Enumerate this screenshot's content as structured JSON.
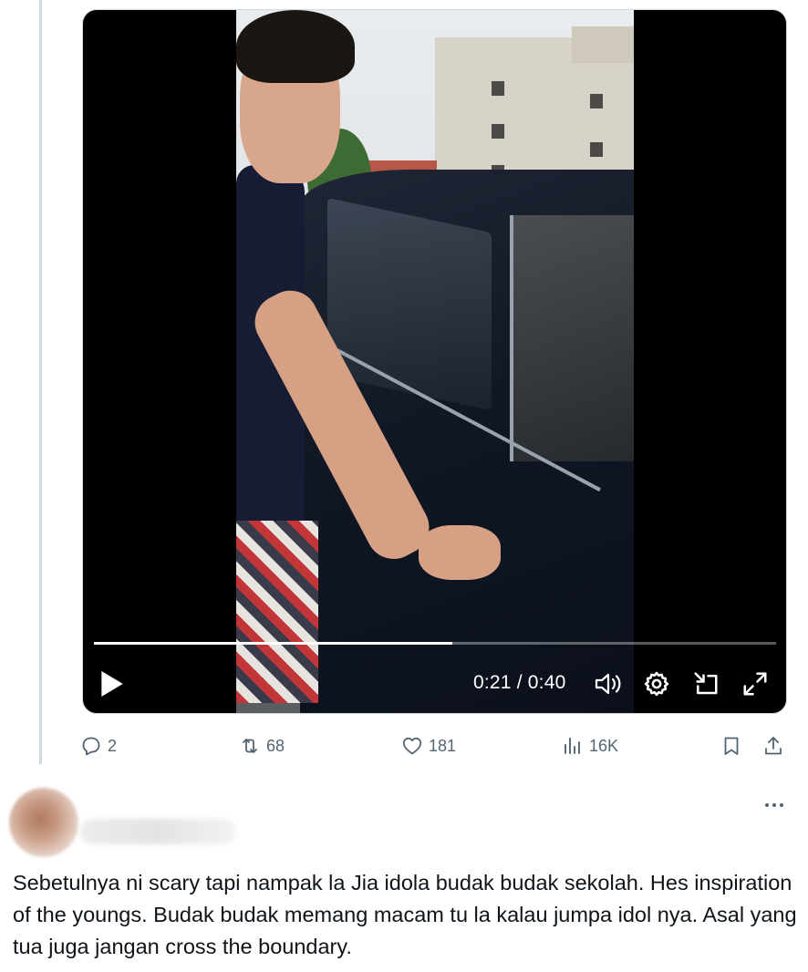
{
  "video": {
    "current_time": "0:21",
    "duration": "0:40",
    "time_display": "0:21 / 0:40",
    "progress": 0.525
  },
  "actions": {
    "replies": "2",
    "reposts": "68",
    "likes": "181",
    "views": "16K"
  },
  "reply": {
    "text": "Sebetulnya ni scary tapi nampak la Jia idola budak budak sekolah. Hes inspiration of the youngs. Budak budak memang macam tu la kalau jumpa idol nya. Asal yang tua juga jangan cross the boundary."
  },
  "colors": {
    "icon_gray": "#536471",
    "text": "#0f1419",
    "thread_line": "#cfd9de"
  }
}
